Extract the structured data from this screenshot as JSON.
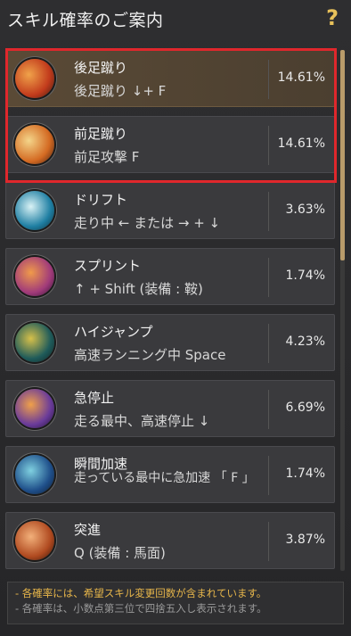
{
  "header": {
    "title": "スキル確率のご案内",
    "help": "?"
  },
  "skills": [
    {
      "name": "後足蹴り",
      "command": "後足蹴り ↓+ F",
      "percent": "14.61%",
      "colors": [
        "#c23b1c",
        "#f0a24a"
      ]
    },
    {
      "name": "前足蹴り",
      "command": "前足攻撃 F",
      "percent": "14.61%",
      "colors": [
        "#d46a22",
        "#f4d58a"
      ]
    },
    {
      "name": "ドリフト",
      "command": "走り中 ← または → + ↓",
      "percent": "3.63%",
      "colors": [
        "#1f7fa3",
        "#d9f2f5"
      ]
    },
    {
      "name": "スプリント",
      "command": "↑ + Shift (装備 : 鞍)",
      "percent": "1.74%",
      "colors": [
        "#a13b7a",
        "#f09a4a"
      ]
    },
    {
      "name": "ハイジャンプ",
      "command": "高速ランニング中 Space",
      "percent": "4.23%",
      "colors": [
        "#1f5b5a",
        "#d6c04a"
      ]
    },
    {
      "name": "急停止",
      "command": "走る最中、高速停止 ↓",
      "percent": "6.69%",
      "colors": [
        "#6a3b9a",
        "#f0a04a"
      ]
    },
    {
      "name": "瞬間加速",
      "command": "走っている最中に急加速 「 F 」",
      "percent": "1.74%",
      "colors": [
        "#1f4f8a",
        "#7fd0e0"
      ]
    },
    {
      "name": "突進",
      "command": "Q (装備 : 馬面)",
      "percent": "3.87%",
      "colors": [
        "#b04a20",
        "#f2b07a"
      ]
    }
  ],
  "notes": [
    "- 各確率には、希望スキル変更回数が含まれています。",
    "- 各確率は、小数点第三位で四捨五入し表示されます。"
  ],
  "accent_colors": {
    "highlight": "#e0272c",
    "help_icon": "#e8c15a",
    "note_text": "#e7b64a",
    "scroll_thumb": "#b89b6a"
  }
}
